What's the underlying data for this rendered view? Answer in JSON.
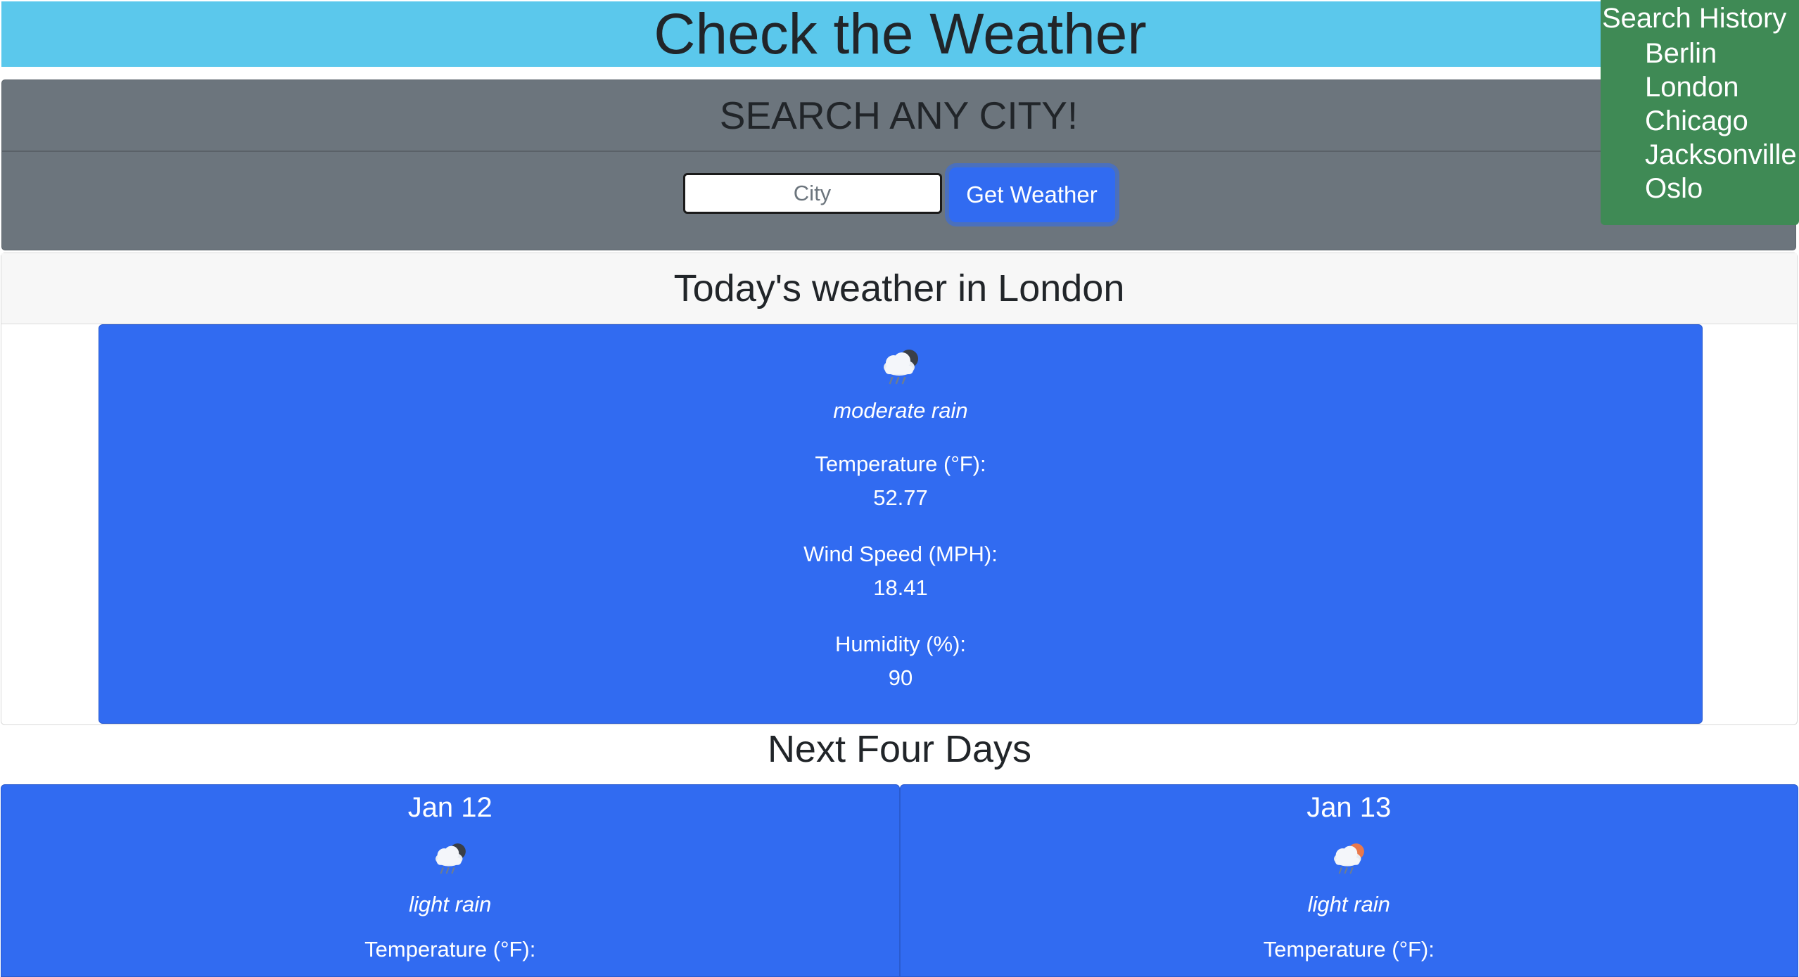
{
  "header": {
    "title": "Check the Weather"
  },
  "search": {
    "title": "SEARCH ANY CITY!",
    "input_placeholder": "City",
    "button_label": "Get Weather"
  },
  "history": {
    "title": "Search History",
    "items": [
      "Berlin",
      "London",
      "Chicago",
      "Jacksonville",
      "Oslo"
    ]
  },
  "today": {
    "heading": "Today's weather in London",
    "icon": "rain-cloud-moon-icon",
    "condition": "moderate rain",
    "temperature_label": "Temperature (°F):",
    "temperature_value": "52.77",
    "wind_label": "Wind Speed (MPH):",
    "wind_value": "18.41",
    "humidity_label": "Humidity (%):",
    "humidity_value": "90"
  },
  "forecast": {
    "heading": "Next Four Days",
    "days": [
      {
        "date": "Jan 12",
        "icon": "rain-cloud-moon-icon",
        "condition": "light rain",
        "temperature_label": "Temperature (°F):"
      },
      {
        "date": "Jan 13",
        "icon": "rain-cloud-sun-icon",
        "condition": "light rain",
        "temperature_label": "Temperature (°F):"
      }
    ]
  },
  "colors": {
    "header_bg": "#5bc8ec",
    "search_bg": "#6c757d",
    "history_bg": "#3f8a55",
    "card_blue": "#316bf1"
  }
}
